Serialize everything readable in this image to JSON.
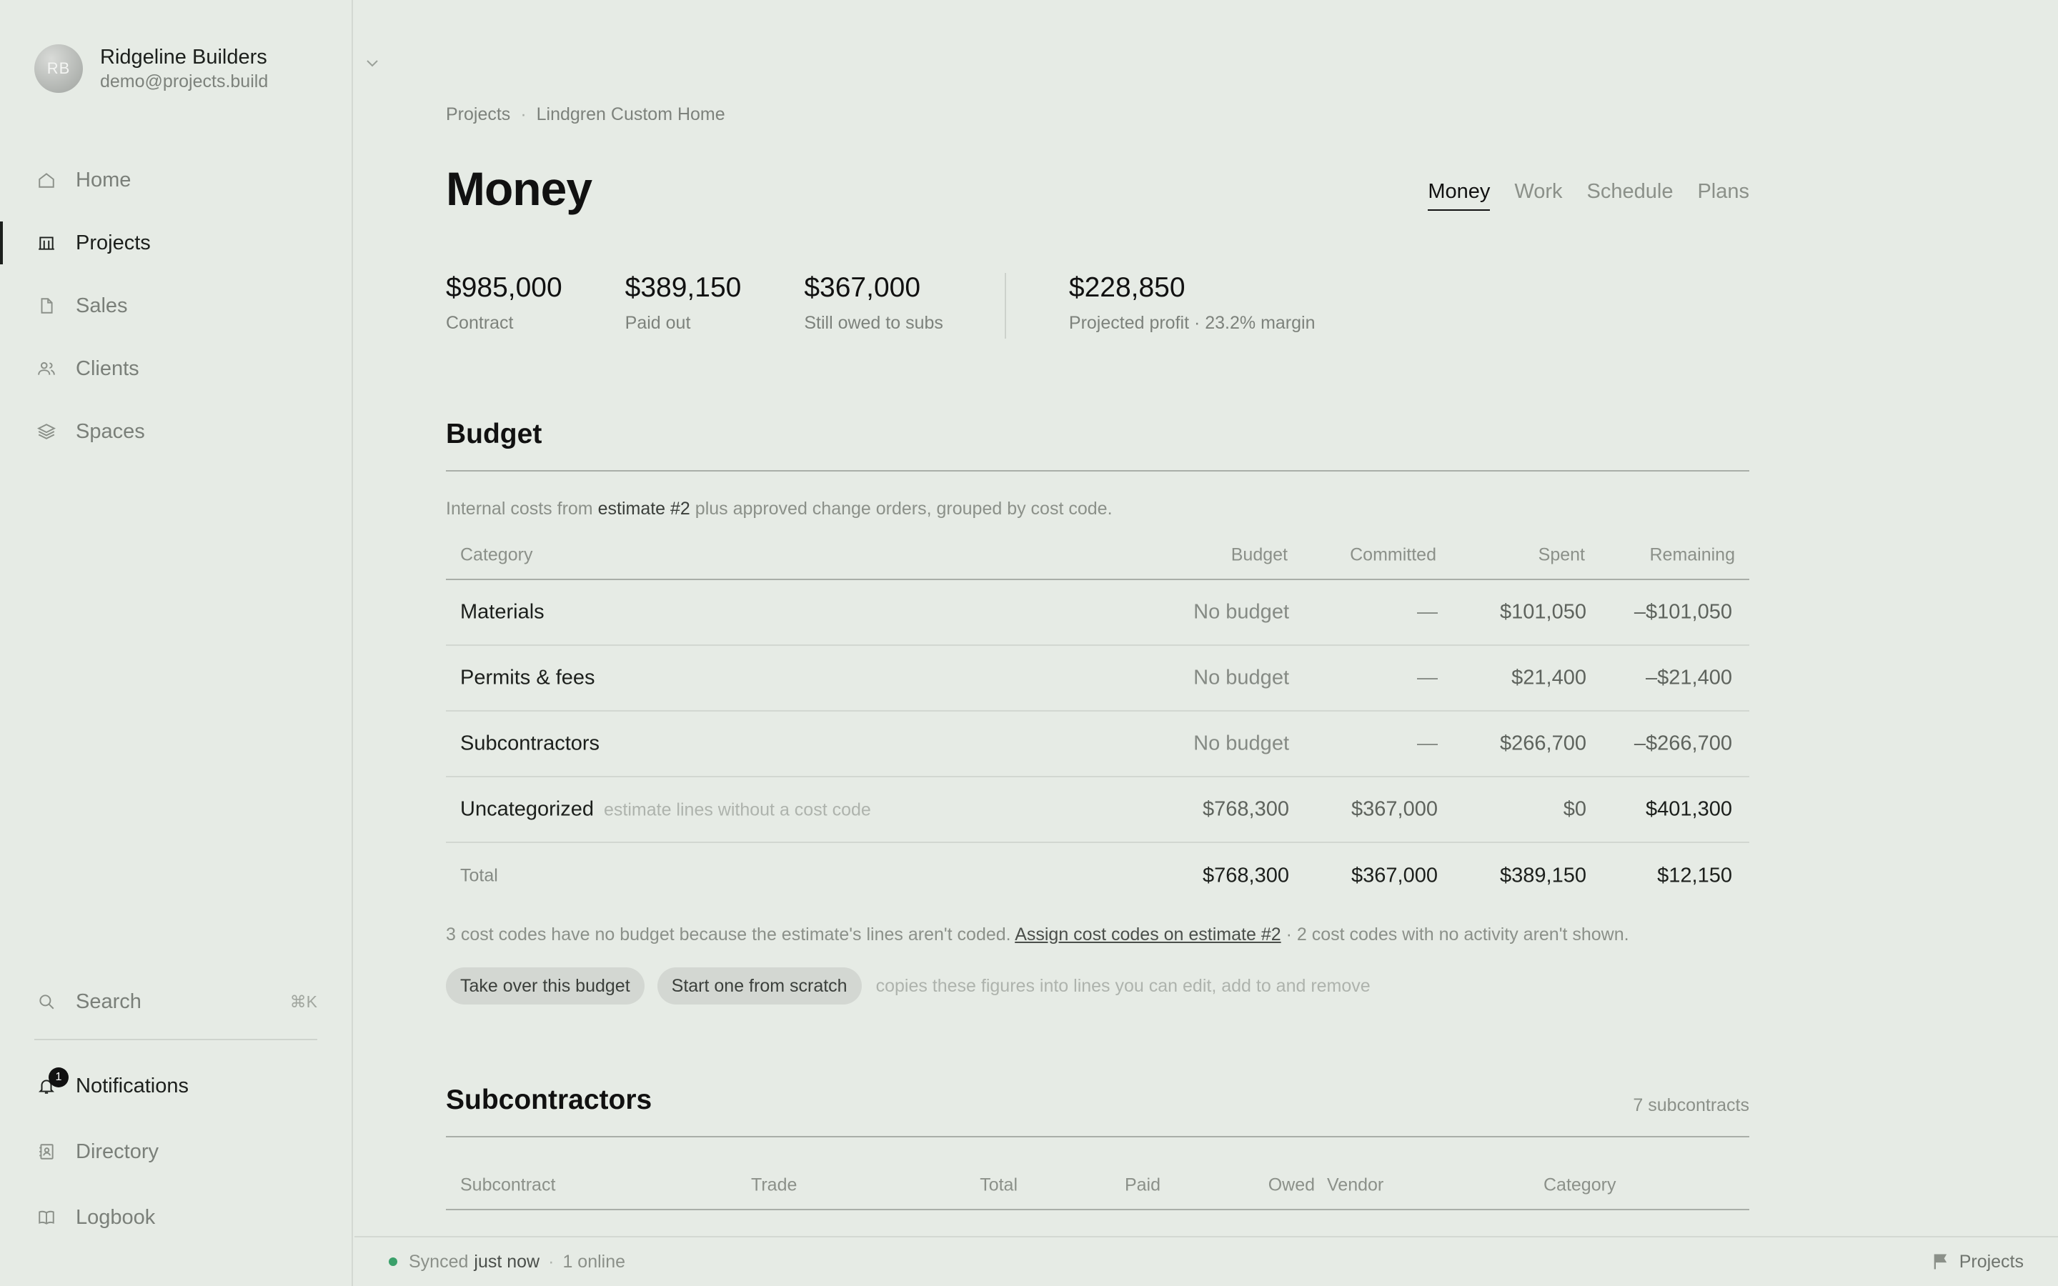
{
  "sidebar": {
    "org": {
      "initials": "RB",
      "name": "Ridgeline Builders",
      "email": "demo@projects.build"
    },
    "nav": [
      {
        "label": "Home",
        "icon": "home-icon"
      },
      {
        "label": "Projects",
        "icon": "building-icon",
        "active": true
      },
      {
        "label": "Sales",
        "icon": "document-icon"
      },
      {
        "label": "Clients",
        "icon": "users-icon"
      },
      {
        "label": "Spaces",
        "icon": "layers-icon"
      }
    ],
    "search": {
      "label": "Search",
      "shortcut": "⌘K"
    },
    "notifications": {
      "label": "Notifications",
      "count": "1"
    },
    "directory": {
      "label": "Directory"
    },
    "logbook": {
      "label": "Logbook"
    }
  },
  "breadcrumb": [
    "Projects",
    "Lindgren Custom Home"
  ],
  "page": {
    "title": "Money",
    "tabs": [
      "Money",
      "Work",
      "Schedule",
      "Plans"
    ],
    "active_tab": "Money"
  },
  "stats": [
    {
      "value": "$985,000",
      "label": "Contract"
    },
    {
      "value": "$389,150",
      "label": "Paid out"
    },
    {
      "value": "$367,000",
      "label": "Still owed to subs"
    },
    {
      "value": "$228,850",
      "label": "Projected profit · 23.2% margin"
    }
  ],
  "budget": {
    "title": "Budget",
    "note_prefix": "Internal costs from",
    "note_link": "estimate #2",
    "note_suffix": "plus approved change orders, grouped by cost code.",
    "columns": [
      "Category",
      "Budget",
      "Committed",
      "Spent",
      "Remaining"
    ],
    "rows": [
      {
        "category": "Materials",
        "hint": "",
        "budget": "No budget",
        "committed": "—",
        "spent": "$101,050",
        "remaining": "–$101,050"
      },
      {
        "category": "Permits & fees",
        "hint": "",
        "budget": "No budget",
        "committed": "—",
        "spent": "$21,400",
        "remaining": "–$21,400"
      },
      {
        "category": "Subcontractors",
        "hint": "",
        "budget": "No budget",
        "committed": "—",
        "spent": "$266,700",
        "remaining": "–$266,700"
      },
      {
        "category": "Uncategorized",
        "hint": "estimate lines without a cost code",
        "budget": "$768,300",
        "committed": "$367,000",
        "spent": "$0",
        "remaining": "$401,300"
      }
    ],
    "total": {
      "label": "Total",
      "budget": "$768,300",
      "committed": "$367,000",
      "spent": "$389,150",
      "remaining": "$12,150"
    },
    "footnote_prefix": "3 cost codes have no budget because the estimate's lines aren't coded.",
    "footnote_link": "Assign cost codes on estimate #2",
    "footnote_suffix": "· 2 cost codes with no activity aren't shown.",
    "actions": [
      "Take over this budget",
      "Start one from scratch"
    ],
    "actions_hint": "copies these figures into lines you can edit, add to and remove"
  },
  "subcontractors": {
    "title": "Subcontractors",
    "count": "7 subcontracts",
    "columns": [
      "Subcontract",
      "Trade",
      "Total",
      "Paid",
      "Owed",
      "Vendor",
      "Category"
    ]
  },
  "footer": {
    "sync_prefix": "Synced",
    "sync_time": "just now",
    "online": "1 online",
    "right_label": "Projects"
  }
}
